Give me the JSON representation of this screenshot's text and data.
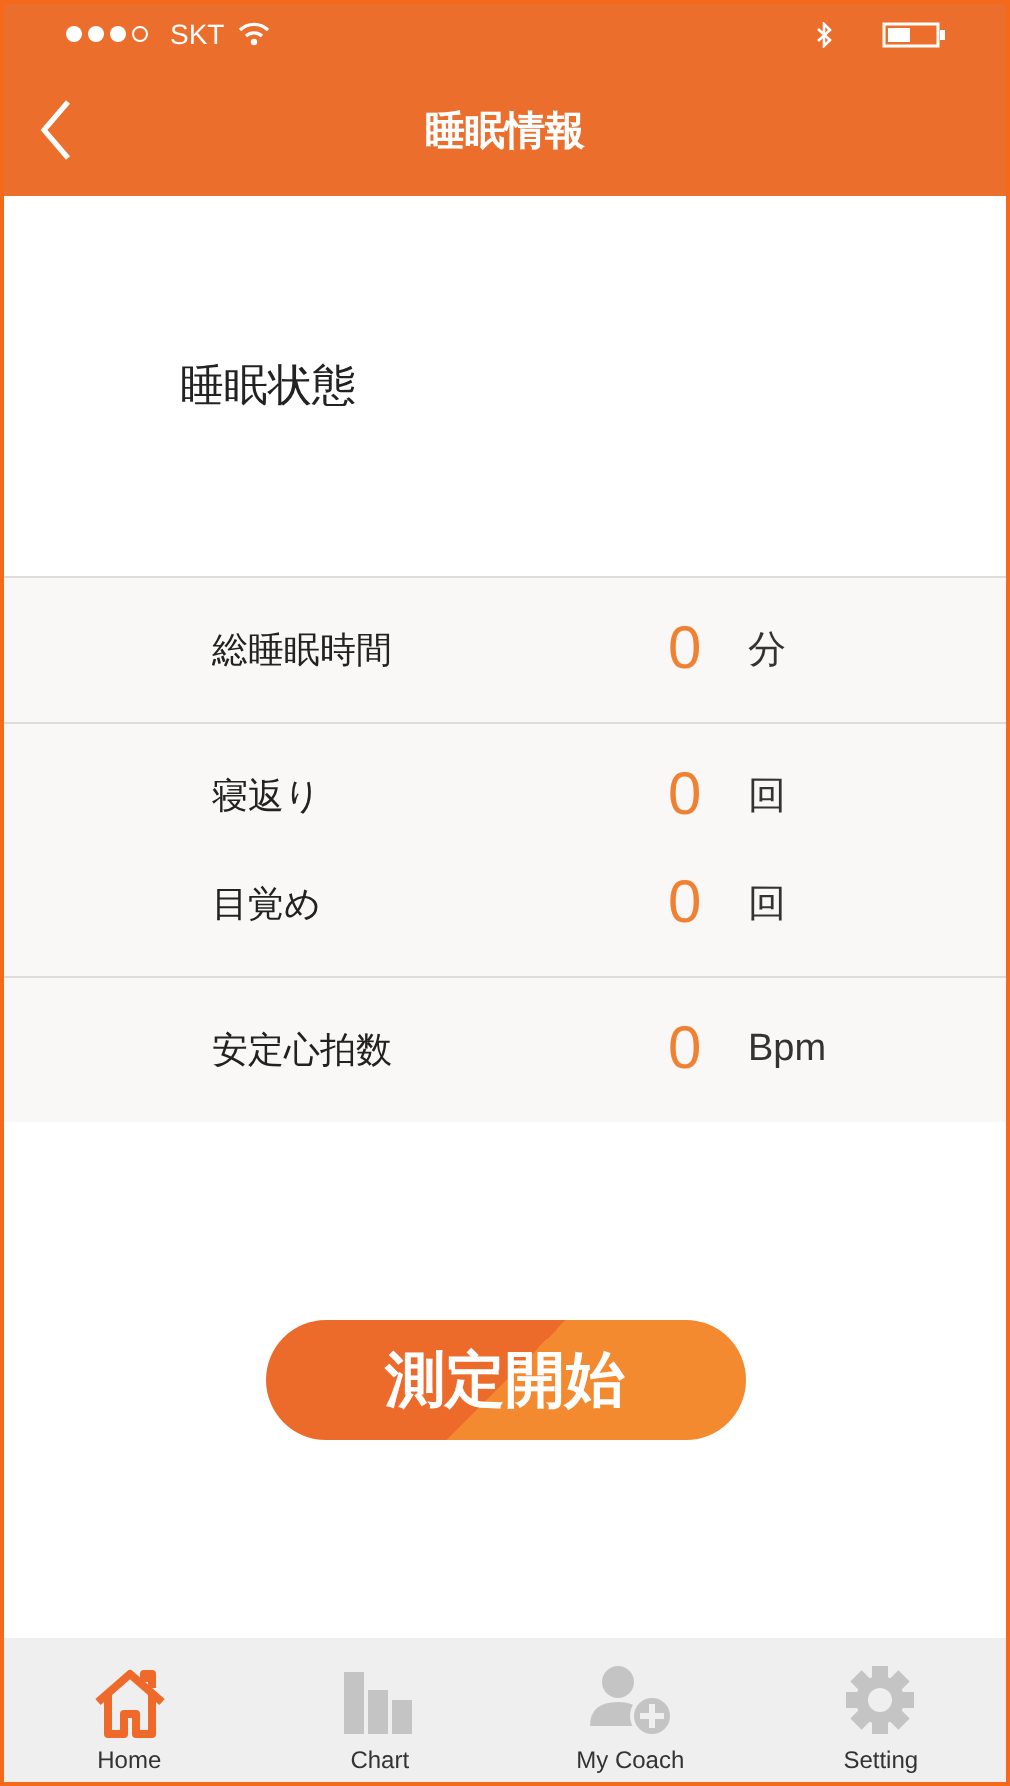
{
  "status_bar": {
    "carrier": "SKT"
  },
  "nav": {
    "title": "睡眠情報"
  },
  "heading": "睡眠状態",
  "sections": [
    {
      "rows": [
        {
          "label": "総睡眠時間",
          "value": "0",
          "unit": "分"
        }
      ]
    },
    {
      "rows": [
        {
          "label": "寝返り",
          "value": "0",
          "unit": "回"
        },
        {
          "label": "目覚め",
          "value": "0",
          "unit": "回"
        }
      ]
    },
    {
      "rows": [
        {
          "label": "安定心拍数",
          "value": "0",
          "unit": "Bpm"
        }
      ]
    }
  ],
  "start_button": "測定開始",
  "tabs": [
    {
      "kind": "home",
      "label": "Home",
      "selected": true
    },
    {
      "kind": "chart",
      "label": "Chart",
      "selected": false
    },
    {
      "kind": "coach",
      "label": "My Coach",
      "selected": false
    },
    {
      "kind": "setting",
      "label": "Setting",
      "selected": false
    }
  ]
}
